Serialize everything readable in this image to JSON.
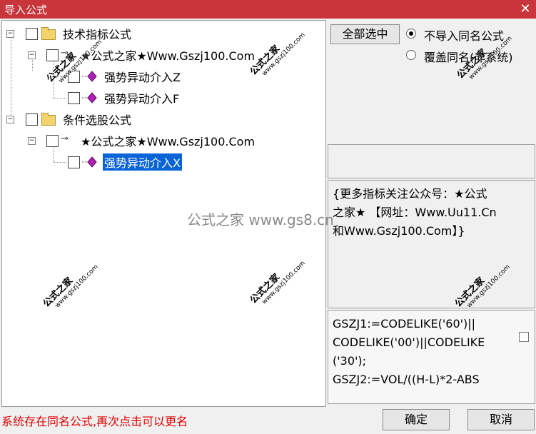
{
  "window": {
    "title": "导入公式",
    "close": "✕"
  },
  "tree": {
    "group1": {
      "label": "技术指标公式",
      "expander": "−"
    },
    "group1_child": {
      "label": "★公式之家★Www.Gszj100.Com",
      "expander": "−"
    },
    "item_z": {
      "label": "强势异动介入Z"
    },
    "item_f": {
      "label": "强势异动介入F"
    },
    "group2": {
      "label": "条件选股公式",
      "expander": "−"
    },
    "group2_child": {
      "label": "★公式之家★Www.Gszj100.Com",
      "expander": "−"
    },
    "item_x": {
      "label": "强势异动介入X"
    }
  },
  "options": {
    "select_all": "全部选中",
    "radio_skip": "不导入同名公式",
    "radio_overwrite": "覆盖同名(非系统)",
    "selected": "radio_skip"
  },
  "description": {
    "line1": "{更多指标关注公众号：★公式",
    "line2": "之家★ 【网址：Www.Uu11.Cn",
    "line3": "和Www.Gszj100.Com】}"
  },
  "code": {
    "line1": "GSZJ1:=CODELIKE('60')||",
    "line2": "CODELIKE('00')||CODELIKE",
    "line3": "('30');",
    "line4": "GSZJ2:=VOL/((H-L)*2-ABS"
  },
  "status": "系统存在同名公式,再次点击可以更名",
  "buttons": {
    "ok": "确定",
    "cancel": "取消"
  },
  "watermarks": {
    "brand": "公式之家",
    "url": "www.gszj100.com",
    "center": "公式之家 www.gs8.cn"
  },
  "colors": {
    "titlebar": "#c8353a",
    "selection": "#0a64d8",
    "status": "#e00000"
  }
}
